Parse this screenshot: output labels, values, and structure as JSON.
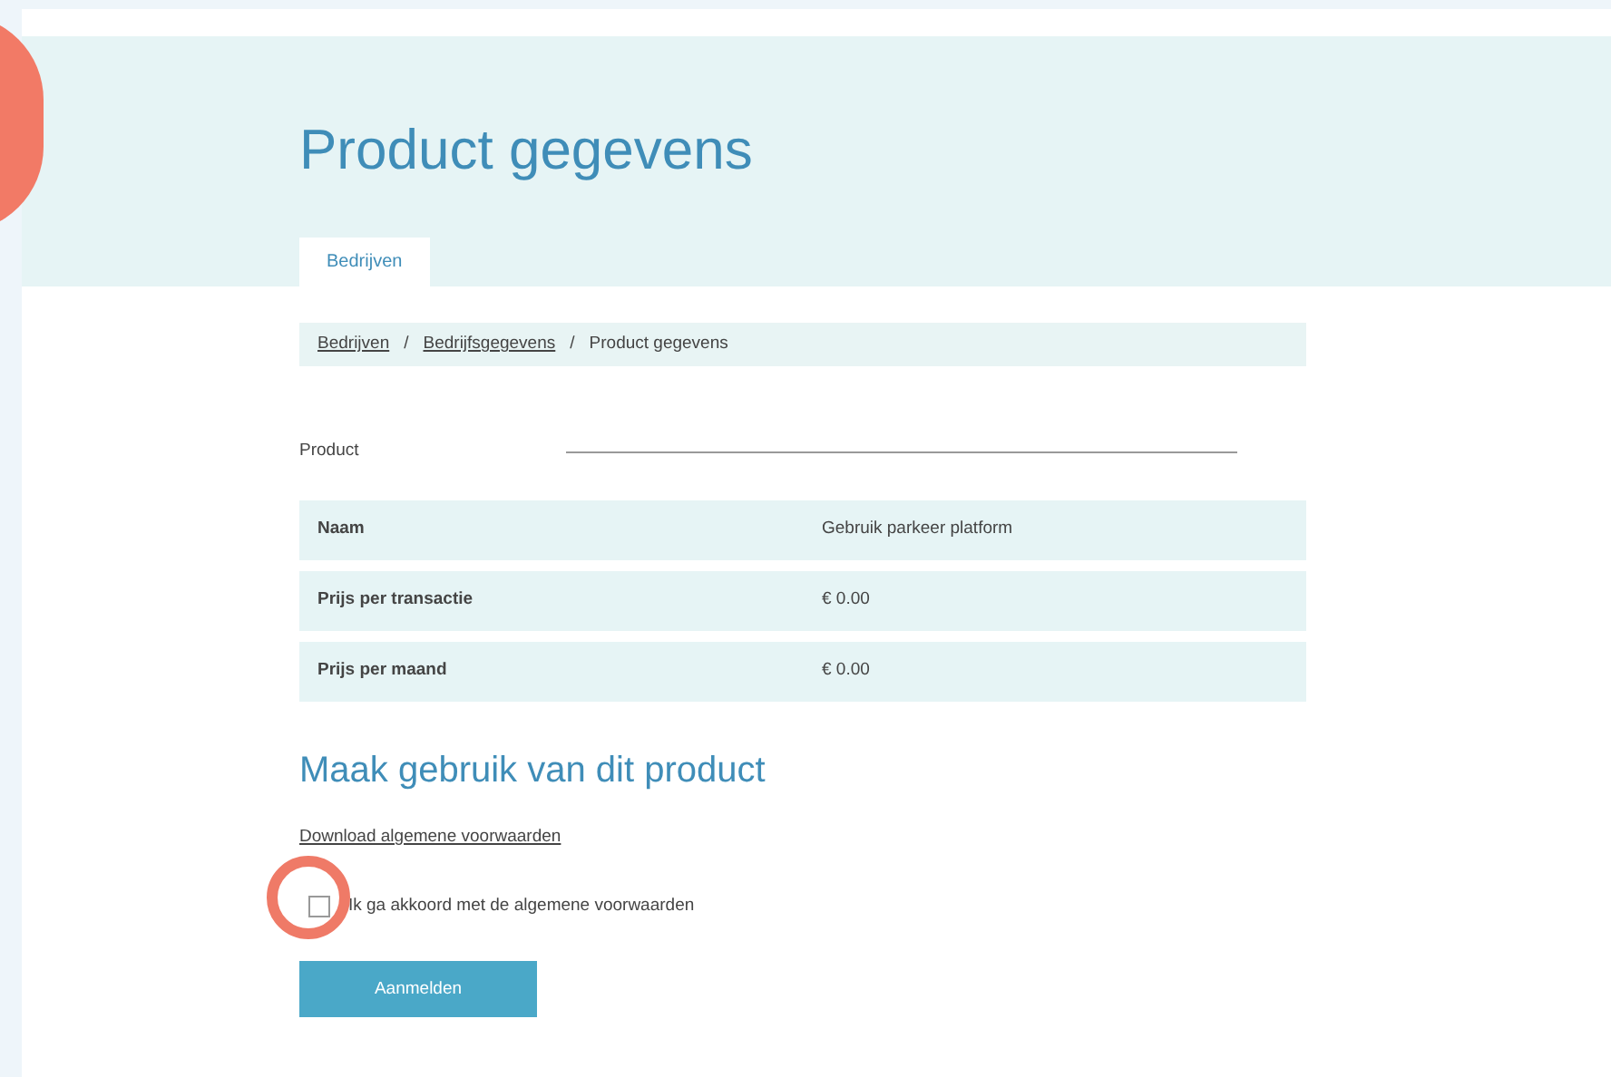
{
  "page_title": "Product gegevens",
  "tabs": [
    {
      "label": "Bedrijven",
      "selected": true
    }
  ],
  "breadcrumb": [
    {
      "label": "Bedrijven",
      "link": true
    },
    {
      "label": "Bedrijfsgegevens",
      "link": true
    },
    {
      "label": "Product gegevens",
      "link": false
    }
  ],
  "breadcrumb_separator": "/",
  "product_label": "Product",
  "product_table": [
    {
      "label": "Naam",
      "value": "Gebruik parkeer platform"
    },
    {
      "label": "Prijs per transactie",
      "value": "€ 0.00"
    },
    {
      "label": "Prijs per maand",
      "value": "€ 0.00"
    }
  ],
  "section_title": "Maak gebruik van dit product",
  "download_link": "Download algemene voorwaarden",
  "terms_checkbox": {
    "label": "Ik ga akkoord met de algemene voorwaarden",
    "checked": false
  },
  "submit_button": "Aanmelden"
}
